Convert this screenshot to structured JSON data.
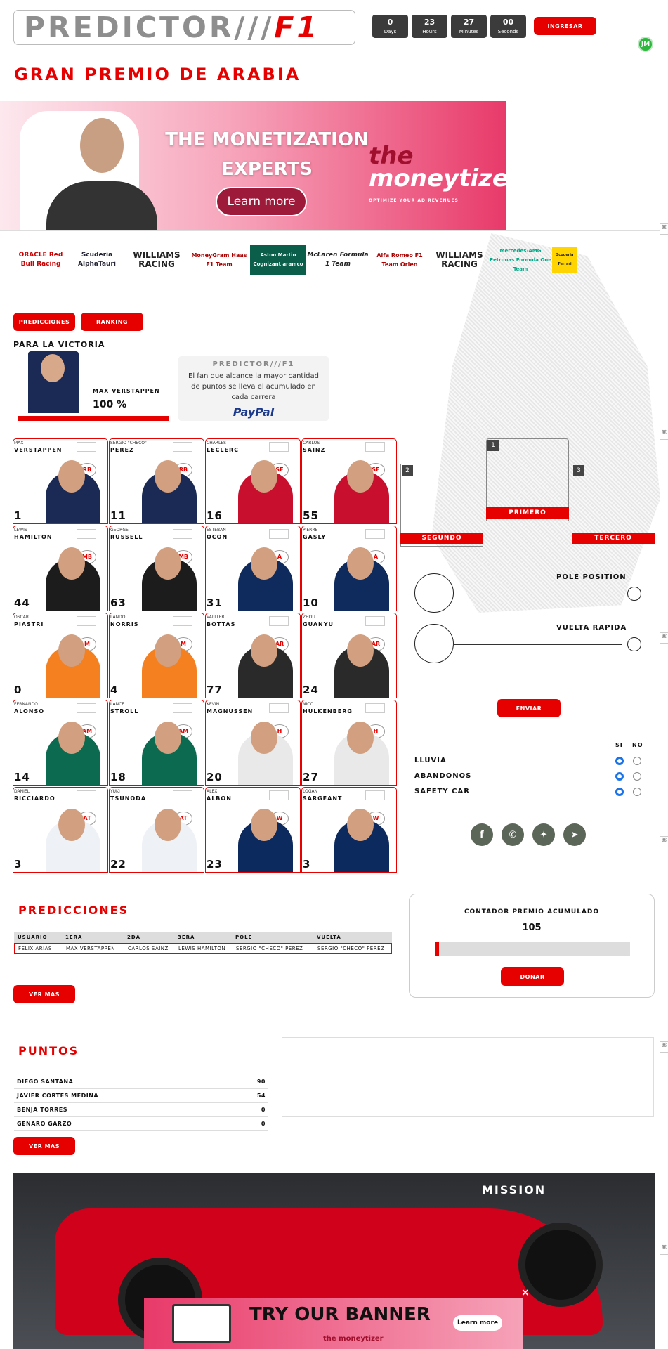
{
  "header": {
    "logo_main": "PREDICTOR///",
    "logo_accent": "F1",
    "countdown": [
      {
        "value": "0",
        "label": "Days"
      },
      {
        "value": "23",
        "label": "Hours"
      },
      {
        "value": "27",
        "label": "Minutes"
      },
      {
        "value": "00",
        "label": "Seconds"
      }
    ],
    "login_label": "INGRESAR",
    "avatar_initials": "JM"
  },
  "race_title": "GRAN PREMIO DE ARABIA",
  "top_ad": {
    "headline_1": "THE MONETIZATION",
    "headline_2": "EXPERTS",
    "cta": "Learn more",
    "brand_the": "the",
    "brand_name": "moneytizer",
    "brand_tag": "OPTIMIZE YOUR AD REVENUES"
  },
  "sponsors": [
    "ORACLE Red Bull Racing",
    "Scuderia AlphaTauri",
    "WILLIAMS RACING",
    "MoneyGram Haas F1 Team",
    "Aston Martin Cognizant aramco",
    "McLaren Formula 1 Team",
    "Alfa Romeo F1 Team Orlen",
    "WILLIAMS RACING",
    "Mercedes-AMG Petronas Formula One Team",
    "Scuderia Ferrari"
  ],
  "tabs": {
    "predictions": "PREDICCIONES",
    "ranking": "RANKING"
  },
  "victory": {
    "label": "PARA LA VICTORIA",
    "driver": "MAX VERSTAPPEN",
    "percent": "100 %",
    "percent_value": 100
  },
  "paypal_promo": {
    "brand": "PREDICTOR///F1",
    "text": "El fan que alcance la mayor cantidad de puntos se lleva el acumulado en cada carrera",
    "paypal": "PayPal"
  },
  "drivers": [
    {
      "first": "MAX",
      "last": "VERSTAPPEN",
      "number": "1",
      "team": "redbull"
    },
    {
      "first": "SERGIO \"CHECO\"",
      "last": "PEREZ",
      "number": "11",
      "team": "redbull"
    },
    {
      "first": "CHARLES",
      "last": "LECLERC",
      "number": "16",
      "team": "ferrari"
    },
    {
      "first": "CARLOS",
      "last": "SAINZ",
      "number": "55",
      "team": "ferrari"
    },
    {
      "first": "LEWIS",
      "last": "HAMILTON",
      "number": "44",
      "team": "mercedes"
    },
    {
      "first": "GEORGE",
      "last": "RUSSELL",
      "number": "63",
      "team": "mercedes"
    },
    {
      "first": "ESTEBAN",
      "last": "OCON",
      "number": "31",
      "team": "alpine"
    },
    {
      "first": "PIERRE",
      "last": "GASLY",
      "number": "10",
      "team": "alpine"
    },
    {
      "first": "OSCAR",
      "last": "PIASTRI",
      "number": "0",
      "team": "mclaren"
    },
    {
      "first": "LANDO",
      "last": "NORRIS",
      "number": "4",
      "team": "mclaren"
    },
    {
      "first": "VALTTERI",
      "last": "BOTTAS",
      "number": "77",
      "team": "alfaromeo"
    },
    {
      "first": "ZHOU",
      "last": "GUANYU",
      "number": "24",
      "team": "alfaromeo"
    },
    {
      "first": "FERNANDO",
      "last": "ALONSO",
      "number": "14",
      "team": "astonmartin"
    },
    {
      "first": "LANCE",
      "last": "STROLL",
      "number": "18",
      "team": "astonmartin"
    },
    {
      "first": "KEVIN",
      "last": "MAGNUSSEN",
      "number": "20",
      "team": "haas"
    },
    {
      "first": "NICO",
      "last": "HULKENBERG",
      "number": "27",
      "team": "haas"
    },
    {
      "first": "DANIEL",
      "last": "RICCIARDO",
      "number": "3",
      "team": "alphatauri"
    },
    {
      "first": "YUKI",
      "last": "TSUNODA",
      "number": "22",
      "team": "alphatauri"
    },
    {
      "first": "ALEX",
      "last": "ALBON",
      "number": "23",
      "team": "williams"
    },
    {
      "first": "LOGAN",
      "last": "SARGEANT",
      "number": "3",
      "team": "williams"
    }
  ],
  "podium": {
    "first_num": "1",
    "first_label": "PRIMERO",
    "second_num": "2",
    "second_label": "SEGUNDO",
    "third_num": "3",
    "third_label": "TERCERO"
  },
  "pole_label": "POLE POSITION",
  "fastest_lap_label": "VUELTA RAPIDA",
  "send_label": "ENVIAR",
  "conditions": {
    "yes": "SI",
    "no": "NO",
    "items": [
      {
        "label": "LLUVIA",
        "value": "SI"
      },
      {
        "label": "ABANDONOS",
        "value": "SI"
      },
      {
        "label": "SAFETY CAR",
        "value": "SI"
      }
    ]
  },
  "social": [
    "facebook",
    "whatsapp",
    "twitter",
    "telegram"
  ],
  "predictions": {
    "title": "PREDICCIONES",
    "columns": [
      "USUARIO",
      "1ERA",
      "2DA",
      "3ERA",
      "POLE",
      "VUELTA"
    ],
    "rows": [
      [
        "FELIX ARIAS",
        "MAX VERSTAPPEN",
        "CARLOS SAINZ",
        "LEWIS HAMILTON",
        "SERGIO \"CHECO\" PEREZ",
        "SERGIO \"CHECO\" PEREZ"
      ]
    ],
    "more_label": "VER MAS"
  },
  "counter": {
    "title": "CONTADOR PREMIO ACUMULADO",
    "value": "105",
    "progress_fraction": 0.02,
    "donate_label": "DONAR"
  },
  "points": {
    "title": "PUNTOS",
    "rows": [
      {
        "name": "DIEGO SANTANA",
        "pts": "90"
      },
      {
        "name": "JAVIER CORTES MEDINA",
        "pts": "54"
      },
      {
        "name": "BENJA TORRES",
        "pts": "0"
      },
      {
        "name": "GENARO GARZO",
        "pts": "0"
      }
    ],
    "more_label": "VER MAS"
  },
  "bottom_ad": {
    "car_text": "MISSION",
    "headline": "TRY OUR BANNER",
    "cta": "Learn more",
    "brand": "the moneytizer",
    "close": "×"
  },
  "colors": {
    "accent": "#e60000",
    "dark": "#3b3b3b",
    "radio": "#1a73e8"
  }
}
